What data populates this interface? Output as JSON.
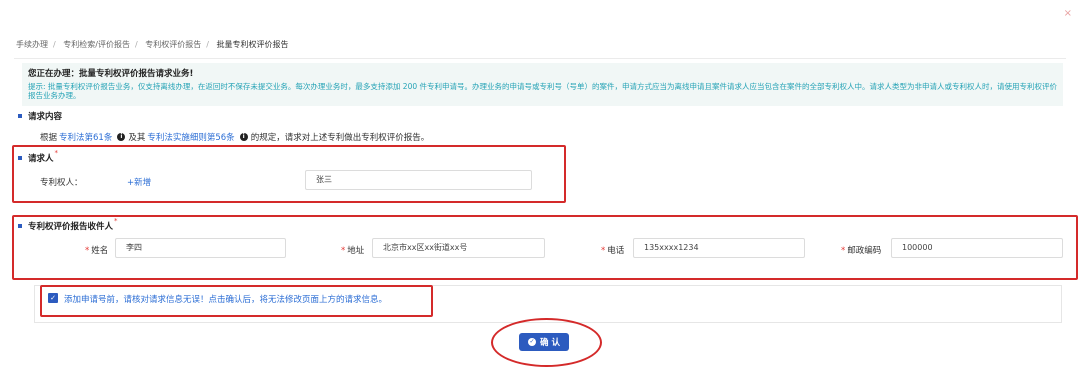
{
  "close_icon": "×",
  "breadcrumb": {
    "items": [
      "手续办理",
      "专利检索/评价报告",
      "专利权评价报告"
    ],
    "current": "批量专利权评价报告"
  },
  "notice": {
    "title": "您正在办理：批量专利权评价报告请求业务!",
    "text": "提示: 批量专利权评价报告业务，仅支持离线办理，在返回时不保存未提交业务。每次办理业务时，最多支持添加 200 件专利申请号。办理业务的申请号或专利号（号单）的案件，申请方式应当为离线申请且案件请求人应当包含在案件的全部专利权人中。请求人类型为非申请人或专利权人时，请使用专利权评价报告业务办理。"
  },
  "request_section": {
    "title": "请求内容"
  },
  "law": {
    "prefix": "根据",
    "link1": "专利法第61条",
    "middle": "及其",
    "link2": "专利法实施细则第56条",
    "suffix": "的规定，请求对上述专利做出专利权评价报告。"
  },
  "requester": {
    "title": "请求人",
    "required_mark": "*",
    "patentee_label": "专利权人：",
    "add_label": "+新增",
    "patentee_value": "张三"
  },
  "recipient": {
    "title": "专利权评价报告收件人",
    "required_mark": "*",
    "name_label": "姓名",
    "name_value": "李四",
    "address_label": "地址",
    "address_value": "北京市xx区xx街道xx号",
    "phone_label": "电话",
    "phone_value": "135xxxx1234",
    "postcode_label": "邮政编码",
    "postcode_value": "100000"
  },
  "confirm": {
    "checkbox_checked": true,
    "text": "添加申请号前，请核对请求信息无误！点击确认后，将无法修改页面上方的请求信息。",
    "button_label": "确 认"
  },
  "colors": {
    "accent": "#2c5bbf",
    "link": "#2c6ed5",
    "annotation_red": "#d42a2a",
    "notice_text": "#26a3b6"
  }
}
